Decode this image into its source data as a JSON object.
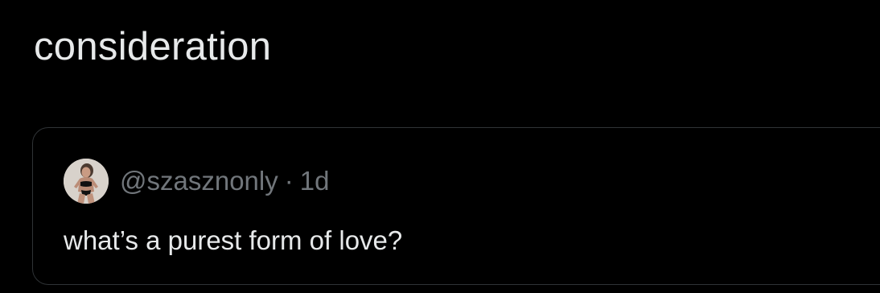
{
  "post": {
    "text": "consideration"
  },
  "quoted_post": {
    "handle": "@szasznonly",
    "separator": "·",
    "time": "1d",
    "text": "what’s a purest form of love?",
    "avatar_icon": "user-avatar-photo"
  },
  "colors": {
    "background": "#000000",
    "primary_text": "#e7e9ea",
    "secondary_text": "#71767b",
    "border": "#2f3336"
  }
}
